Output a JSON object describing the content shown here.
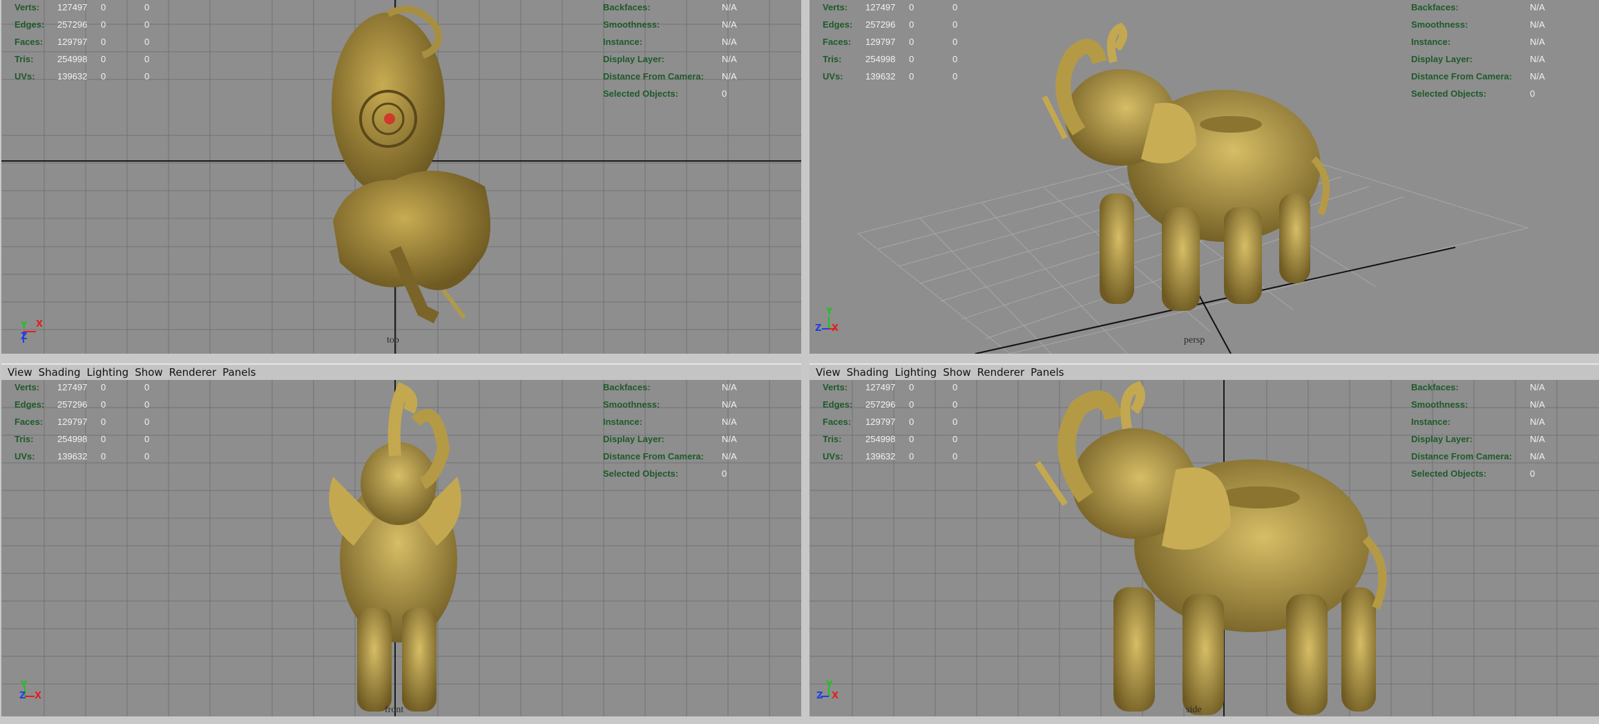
{
  "menu": [
    "View",
    "Shading",
    "Lighting",
    "Show",
    "Renderer",
    "Panels"
  ],
  "hud_left": [
    {
      "label": "Verts:",
      "v1": "127497",
      "v2": "0",
      "v3": "0"
    },
    {
      "label": "Edges:",
      "v1": "257296",
      "v2": "0",
      "v3": "0"
    },
    {
      "label": "Faces:",
      "v1": "129797",
      "v2": "0",
      "v3": "0"
    },
    {
      "label": "Tris:",
      "v1": "254998",
      "v2": "0",
      "v3": "0"
    },
    {
      "label": "UVs:",
      "v1": "139632",
      "v2": "0",
      "v3": "0"
    }
  ],
  "hud_right": [
    {
      "label": "Backfaces:",
      "value": "N/A"
    },
    {
      "label": "Smoothness:",
      "value": "N/A"
    },
    {
      "label": "Instance:",
      "value": "N/A"
    },
    {
      "label": "Display Layer:",
      "value": "N/A"
    },
    {
      "label": "Distance From Camera:",
      "value": "N/A"
    },
    {
      "label": "Selected Objects:",
      "value": "0"
    }
  ],
  "viewports": {
    "top": {
      "camera": "top"
    },
    "persp": {
      "camera": "persp"
    },
    "front": {
      "camera": "front"
    },
    "side": {
      "camera": "side"
    }
  },
  "axes": {
    "x": "X",
    "y": "Y",
    "z": "Z"
  },
  "colors": {
    "viewport_bg": "#8e8e8e",
    "grid": "#6f6f6f",
    "hud_label": "#1e5a2a",
    "model_gold": "#b59a45",
    "axis_x": "#e02020",
    "axis_y": "#20c020",
    "axis_z": "#2040e0"
  }
}
